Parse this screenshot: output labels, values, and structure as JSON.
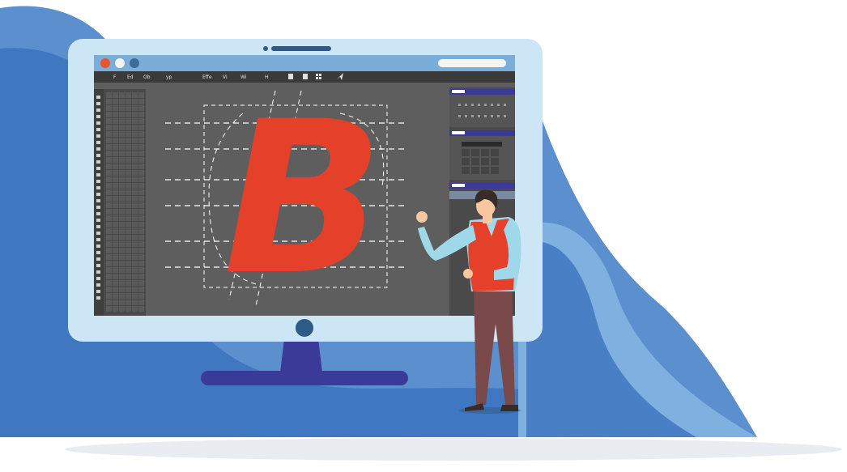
{
  "colors": {
    "backdrop_dark": "#3f78c0",
    "backdrop_mid": "#5b8fce",
    "backdrop_light": "#7fb1e0",
    "monitor_bezel": "#cce6f6",
    "monitor_stand": "#3b3a98",
    "app_titlebar": "#7aaed8",
    "app_menubar": "#3a3a3a",
    "app_canvas": "#5e5e5e",
    "app_toolbar": "#3f3f3f",
    "panel_accent": "#3b3a98",
    "letter": "#e5412a",
    "window_close": "#e8552c",
    "window_minimize": "#f4f4f4",
    "window_maximize": "#3c6c99",
    "vest": "#e5412a",
    "shirt": "#9fd8e8",
    "pants": "#7a4a4a",
    "hair": "#3a2b2b",
    "skin": "#f7c7a0"
  },
  "app": {
    "menu": [
      "F",
      "Ed",
      "Ob",
      "yp",
      "Effe",
      "Vi",
      "Wi",
      "H"
    ],
    "letter": "B"
  },
  "icons": {
    "window_controls": [
      "close-dot-icon",
      "minimize-dot-icon",
      "maximize-dot-icon"
    ],
    "toolbar": [
      "arrange-icon",
      "layout-icon",
      "grid-icon",
      "send-icon"
    ]
  }
}
